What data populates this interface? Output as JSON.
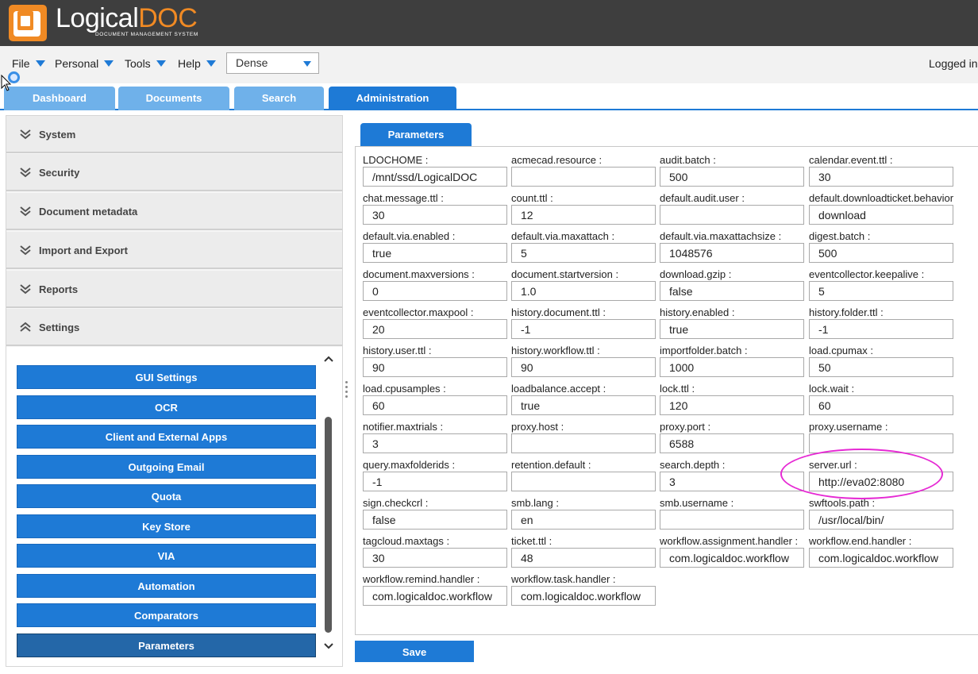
{
  "app": {
    "logo_main": "Logical",
    "logo_accent": "DOC",
    "logo_subtitle": "DOCUMENT MANAGEMENT SYSTEM"
  },
  "menubar": {
    "items": [
      "File",
      "Personal",
      "Tools",
      "Help"
    ],
    "density_value": "Dense",
    "logged_in": "Logged in"
  },
  "tabs": [
    {
      "label": "Dashboard",
      "active": false
    },
    {
      "label": "Documents",
      "active": false
    },
    {
      "label": "Search",
      "active": false
    },
    {
      "label": "Administration",
      "active": true
    }
  ],
  "sidebar": {
    "sections": [
      {
        "label": "System",
        "expanded": false
      },
      {
        "label": "Security",
        "expanded": false
      },
      {
        "label": "Document metadata",
        "expanded": false
      },
      {
        "label": "Import and Export",
        "expanded": false
      },
      {
        "label": "Reports",
        "expanded": false
      },
      {
        "label": "Settings",
        "expanded": true
      }
    ],
    "settings_items": [
      {
        "label": "GUI Settings",
        "selected": false
      },
      {
        "label": "OCR",
        "selected": false
      },
      {
        "label": "Client and External Apps",
        "selected": false
      },
      {
        "label": "Outgoing Email",
        "selected": false
      },
      {
        "label": "Quota",
        "selected": false
      },
      {
        "label": "Key Store",
        "selected": false
      },
      {
        "label": "VIA",
        "selected": false
      },
      {
        "label": "Automation",
        "selected": false
      },
      {
        "label": "Comparators",
        "selected": false
      },
      {
        "label": "Parameters",
        "selected": true
      }
    ]
  },
  "main": {
    "tab_label": "Parameters",
    "save_label": "Save",
    "parameters": [
      {
        "label": "LDOCHOME :",
        "value": "/mnt/ssd/LogicalDOC"
      },
      {
        "label": "acmecad.resource :",
        "value": ""
      },
      {
        "label": "audit.batch :",
        "value": "500"
      },
      {
        "label": "calendar.event.ttl :",
        "value": "30"
      },
      {
        "label": "chat.message.ttl :",
        "value": "30"
      },
      {
        "label": "count.ttl :",
        "value": "12"
      },
      {
        "label": "default.audit.user :",
        "value": ""
      },
      {
        "label": "default.downloadticket.behavior :",
        "value": "download"
      },
      {
        "label": "default.via.enabled :",
        "value": "true"
      },
      {
        "label": "default.via.maxattach :",
        "value": "5"
      },
      {
        "label": "default.via.maxattachsize :",
        "value": "1048576"
      },
      {
        "label": "digest.batch :",
        "value": "500"
      },
      {
        "label": "document.maxversions :",
        "value": "0"
      },
      {
        "label": "document.startversion :",
        "value": "1.0"
      },
      {
        "label": "download.gzip :",
        "value": "false"
      },
      {
        "label": "eventcollector.keepalive :",
        "value": "5"
      },
      {
        "label": "eventcollector.maxpool :",
        "value": "20"
      },
      {
        "label": "history.document.ttl :",
        "value": "-1"
      },
      {
        "label": "history.enabled :",
        "value": "true"
      },
      {
        "label": "history.folder.ttl :",
        "value": "-1"
      },
      {
        "label": "history.user.ttl :",
        "value": "90"
      },
      {
        "label": "history.workflow.ttl :",
        "value": "90"
      },
      {
        "label": "importfolder.batch :",
        "value": "1000"
      },
      {
        "label": "load.cpumax :",
        "value": "50"
      },
      {
        "label": "load.cpusamples :",
        "value": "60"
      },
      {
        "label": "loadbalance.accept :",
        "value": "true"
      },
      {
        "label": "lock.ttl :",
        "value": "120"
      },
      {
        "label": "lock.wait :",
        "value": "60"
      },
      {
        "label": "notifier.maxtrials :",
        "value": "3"
      },
      {
        "label": "proxy.host :",
        "value": ""
      },
      {
        "label": "proxy.port :",
        "value": "6588"
      },
      {
        "label": "proxy.username :",
        "value": ""
      },
      {
        "label": "query.maxfolderids :",
        "value": "-1"
      },
      {
        "label": "retention.default :",
        "value": ""
      },
      {
        "label": "search.depth :",
        "value": "3"
      },
      {
        "label": "server.url :",
        "value": "http://eva02:8080",
        "highlighted": true
      },
      {
        "label": "sign.checkcrl :",
        "value": "false"
      },
      {
        "label": "smb.lang :",
        "value": "en"
      },
      {
        "label": "smb.username :",
        "value": ""
      },
      {
        "label": "swftools.path :",
        "value": "/usr/local/bin/"
      },
      {
        "label": "tagcloud.maxtags :",
        "value": "30"
      },
      {
        "label": "ticket.ttl :",
        "value": "48"
      },
      {
        "label": "workflow.assignment.handler :",
        "value": "com.logicaldoc.workflow"
      },
      {
        "label": "workflow.end.handler :",
        "value": "com.logicaldoc.workflow"
      },
      {
        "label": "workflow.remind.handler :",
        "value": "com.logicaldoc.workflow"
      },
      {
        "label": "workflow.task.handler :",
        "value": "com.logicaldoc.workflow"
      }
    ]
  },
  "colors": {
    "header_bg": "#3e3e3e",
    "accent_orange": "#f08a24",
    "primary_blue": "#1e7ad6",
    "tab_inactive": "#6fb1ea",
    "annotation_magenta": "#e62ad4"
  }
}
